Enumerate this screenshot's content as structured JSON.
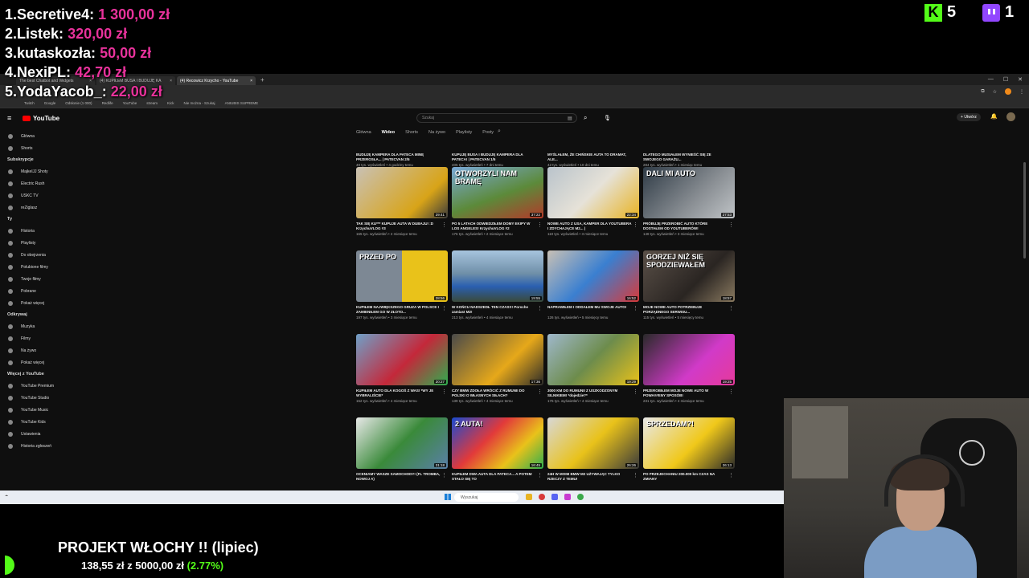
{
  "overlay": {
    "leaderboard": [
      {
        "rank": "1.",
        "name": "Secretive4:",
        "amount": "1 300,00 zł"
      },
      {
        "rank": "2.",
        "name": "Listek:",
        "amount": "320,00 zł"
      },
      {
        "rank": "3.",
        "name": "kutaskozła:",
        "amount": "50,00 zł"
      },
      {
        "rank": "4.",
        "name": "NexiPL:",
        "amount": "42,70 zł"
      },
      {
        "rank": "5.",
        "name": "YodaYacob_:",
        "amount": "22,00 zł"
      }
    ],
    "kick_viewers": "5",
    "twitch_viewers": "1",
    "goal": {
      "title": "PROJEKT WŁOCHY !! (lipiec)",
      "current": "138,55 zł",
      "separator": "z",
      "target": "5000,00 zł",
      "percent_text": "(2.77%)",
      "percent": 2.77
    },
    "colors": {
      "amount": "#e8329b",
      "kick": "#53fc18",
      "twitch": "#9146ff"
    }
  },
  "browser": {
    "tabs": [
      {
        "title": "The best Chatbot and Widgets"
      },
      {
        "title": "(4) KUPIŁEM BUSA I BUDUJĘ KA"
      },
      {
        "title": "(4) Recowicz Krzycho - YouTube"
      }
    ],
    "bookmarks": [
      "Twitch",
      "Google",
      "Odsłonie (1 000)",
      "Redlife",
      "YouTube",
      "stream",
      "Kick",
      "Nie można - Szukaj",
      "ANIUBIS SUPREME"
    ]
  },
  "youtube": {
    "logo": "YouTube",
    "search_placeholder": "Szukaj",
    "create_label": "Utwórz",
    "sidebar": {
      "top": [
        "Główna",
        "Shorts"
      ],
      "subs_header": "Subskrypcje",
      "subs": [
        "MajkelJJ Shoty",
        "Electric Rush",
        "USKC TV",
        "reZiglasz"
      ],
      "you_header": "Ty",
      "you": [
        "Historia",
        "Playlisty",
        "Do obejrzenia",
        "Polubione filmy",
        "Twoje filmy",
        "Pobrane",
        "Pokaż więcej"
      ],
      "explore_header": "Odkrywaj",
      "explore": [
        "Muzyka",
        "Filmy",
        "Na żywo",
        "Pokaż więcej"
      ],
      "more_header": "Więcej z YouTube",
      "more": [
        "YouTube Premium",
        "YouTube Studio",
        "YouTube Music",
        "YouTube Kids"
      ],
      "bottom": [
        "Ustawienia",
        "Historia zgłoszeń"
      ]
    },
    "channel_tabs": [
      "Główna",
      "Wideo",
      "Shorts",
      "Na żywo",
      "Playlisty",
      "Posty"
    ],
    "active_tab": "Wideo",
    "partial_row": [
      {
        "title": "BUDUJĘ KAMPERA DLA PATECA MINĘ PRZEROSŁA... | PATECVAN 2/5",
        "meta": "49 tys. wyświetleń • 4 godziny temu"
      },
      {
        "title": "KUPUJĘ BUSA I BUDUJĘ KAMPERA DLA PATECA! | PATECVAN 1/5",
        "meta": "405 tys. wyświetleń • 7 dni temu"
      },
      {
        "title": "MYŚLAŁEM, ŻE CHIŃSKIE AUTA TO DRAMAT, ALE...",
        "meta": "42 tys. wyświetleń • 10 dni temu"
      },
      {
        "title": "DLATEGO MUSIAŁEM WYNIEŚĆ SIĘ ZE SWOJEGO GARAŻU...",
        "meta": "284 tys. wyświetleń • 1 miesiąc temu"
      }
    ],
    "videos": [
      [
        {
          "title": "TAK SIĘ KU*** KUPUJE AUTA W DUBAJU! :D KrzychuVLOG #3",
          "meta": "165 tys. wyświetleń • 2 miesiące temu",
          "dur": "29:41",
          "overlay": "",
          "bg": "linear-gradient(135deg,#c9c1b5,#d8a418 70%,#3b3b3b)"
        },
        {
          "title": "PO 5 LATACH ODWIEDZIŁEM DOMY EKIPY W LOS ANGELES! KrzychuVLOG #2",
          "meta": "176 tys. wyświetleń • 2 miesiące temu",
          "dur": "37:22",
          "overlay": "OTWORZYLI NAM BRAMĘ",
          "bg": "linear-gradient(160deg,#7aa9d8,#5c8a3a 55%,#b23a2a)"
        },
        {
          "title": "NOWE AUTO Z USA, KAMPER DLA YOUTUBERA I ZDYCHAJĄCE M2... |",
          "meta": "110 tys. wyświetleń • 3 miesiące temu",
          "dur": "22:34",
          "overlay": "",
          "bg": "linear-gradient(135deg,#b9c3cb,#e6e2d8 50%,#e8b322)"
        },
        {
          "title": "PRÓBUJĘ PRZEROBIĆ AUTO KTÓRE DOSTAŁEM OD YOUTUBERÓW!",
          "meta": "148 tys. wyświetleń • 3 miesiące temu",
          "dur": "27:53",
          "overlay": "DALI MI AUTO",
          "bg": "linear-gradient(135deg,#2f3b46,#8a8f94 60%,#c0c4c7)"
        }
      ],
      [
        {
          "title": "KUPIŁEM NAJWIĘKSZEGO GRUZA W POLSCE I ZAMIENIŁEM GO W ZŁOTO...",
          "meta": "197 tys. wyświetleń • 3 miesiące temu",
          "dur": "28:56",
          "overlay": "PRZED PO",
          "bg": "linear-gradient(90deg,#7d8894 50%,#e9c21a 50%)"
        },
        {
          "title": "W KOŃCU NADSZEDŁ TEN CZAS!!! Porsche zamiast M2!",
          "meta": "213 tys. wyświetleń • 4 miesiące temu",
          "dur": "19:55",
          "overlay": "",
          "bg": "linear-gradient(180deg,#a7c4de,#6f8fa8 45%,#2a5fb0 70%,#3a4a3a)"
        },
        {
          "title": "NAPRAWIŁEM I ODDAŁEM MU SWOJE AUTO!",
          "meta": "126 tys. wyświetleń • 5 miesięcy temu",
          "dur": "16:52",
          "overlay": "",
          "bg": "linear-gradient(135deg,#c8c0b5,#3a7fd0 50%,#d83a3a)"
        },
        {
          "title": "MOJE NOWE AUTO POTRZEBUJE PORZĄDNEGO SERWISU...",
          "meta": "115 tys. wyświetleń • 5 miesięcy temu",
          "dur": "18:57",
          "overlay": "GORZEJ NIŻ SIĘ SPODZIEWAŁEM",
          "bg": "linear-gradient(135deg,#5a5048,#2a2522 60%,#8a7a60)"
        }
      ],
      [
        {
          "title": "KUPIŁEM AUTO DLA KOGOŚ Z WAS! *WY JE WYBRALIŚCIE*",
          "meta": "152 tys. wyświetleń • 4 miesiące temu",
          "dur": "20:27",
          "overlay": "",
          "bg": "linear-gradient(135deg,#6fa0c8,#c4283a 55%,#2fae4f)"
        },
        {
          "title": "CZY BMW ZDOŁA WRÓCIĆ Z RUMUNII DO POLSKI O WŁASNYCH SIŁACH?",
          "meta": "139 tys. wyświetleń • 4 miesiące temu",
          "dur": "17:36",
          "overlay": "",
          "bg": "linear-gradient(135deg,#4a4a4a,#e6a81a 60%,#2a2a2a)"
        },
        {
          "title": "3000 KM DO RUMUNII Z USZKODZONYM SILNIKIEM! *dojedzie?*",
          "meta": "176 tys. wyświetleń • 4 miesiące temu",
          "dur": "19:29",
          "overlay": "",
          "bg": "linear-gradient(135deg,#9fb8cc,#6d8c4c 50%,#e9c21a)"
        },
        {
          "title": "PRZEROBIŁEM MOJE NOWE AUTO W POWA##ENY SPOSÓB!",
          "meta": "231 tys. wyświetleń • 4 miesiące temu",
          "dur": "19:25",
          "overlay": "",
          "bg": "linear-gradient(135deg,#2a2a2a,#d13ac8 60%,#e63a9a)"
        }
      ],
      [
        {
          "title": "OCENIAMY WASZE SAMOCHODY! (FL TROMBA, NOWOJ A)",
          "meta": "",
          "dur": "31:18",
          "overlay": "",
          "bg": "linear-gradient(135deg,#e8e8e8,#3a8a3a 50%,#5a7fa8)"
        },
        {
          "title": "KUPIŁEM DWA AUTA DLA PATECA... A POTEM STAŁO SIĘ TO",
          "meta": "",
          "dur": "16:45",
          "overlay": "2 AUTA!",
          "bg": "linear-gradient(135deg,#1a4ad0,#e23a3a 40%,#e9c21a 70%,#2fae4f)"
        },
        {
          "title": "24H W MOIM BMW M2 UŻYWAJĄC TYLKO RZECZY Z TEMU!",
          "meta": "",
          "dur": "26:26",
          "overlay": "",
          "bg": "linear-gradient(135deg,#d8d8d8,#e9c21a 50%,#3a3a3a)"
        },
        {
          "title": "PO PRZEJECHANIU 200.000 km CZAS NA ZMIANY",
          "meta": "",
          "dur": "26:13",
          "overlay": "SPRZEDAM?!",
          "bg": "linear-gradient(135deg,#e8e8e8,#f0c81a 55%,#2a2a2a)"
        }
      ]
    ]
  },
  "taskbar": {
    "search_placeholder": "Wyszukaj"
  }
}
